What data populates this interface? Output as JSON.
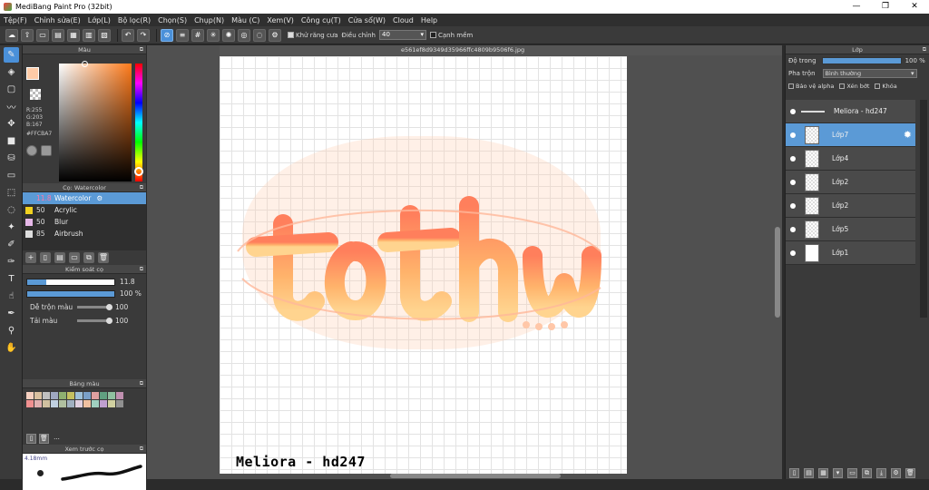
{
  "window": {
    "title": "MediBang Paint Pro (32bit)",
    "minimize": "—",
    "restore": "❐",
    "close": "✕"
  },
  "menu": [
    "Tệp(F)",
    "Chỉnh sửa(E)",
    "Lớp(L)",
    "Bộ lọc(R)",
    "Chọn(S)",
    "Chụp(N)",
    "Màu (C)",
    "Xem(V)",
    "Công cụ(T)",
    "Cửa sổ(W)",
    "Cloud",
    "Help"
  ],
  "toolbar": {
    "antialias_label": "Khử răng cưa",
    "adjust_label": "Điều chỉnh",
    "adjust_value": "40",
    "smooth_label": "Cạnh mềm"
  },
  "color_panel": {
    "title": "Màu",
    "r": "R:255",
    "g": "G:203",
    "b": "B:167",
    "hex": "#FFCBA7",
    "fg_color": "#FFCBA7"
  },
  "brush_panel": {
    "title": "Cọ: Watercolor",
    "brushes": [
      {
        "size": "11.8",
        "name": "Watercolor",
        "color": "#5b9ad6"
      },
      {
        "size": "50",
        "name": "Acrylic",
        "color": "#f0d020"
      },
      {
        "size": "50",
        "name": "Blur",
        "color": "#e6b8e8"
      },
      {
        "size": "85",
        "name": "Airbrush",
        "color": "#dddddd"
      }
    ]
  },
  "brush_control": {
    "title": "Kiểm soát cọ",
    "size_value": "11.8",
    "size_fraction": 0.22,
    "opacity_value": "100 %",
    "blend_label": "Dễ trộn màu",
    "blend_value": "100",
    "amount_label": "Tải màu",
    "amount_value": "100"
  },
  "palette": {
    "title": "Bảng màu",
    "dots": "...",
    "colors": [
      "#f6d0c0",
      "#d9c0a0",
      "#c0c0c0",
      "#9fa8c0",
      "#8fb070",
      "#c4c060",
      "#9ec0d8",
      "#7aa0c8",
      "#e0a0a0",
      "#60a080",
      "#90c0a0",
      "#c090b0",
      "#f09090",
      "#e0b0b0",
      "#d0c0a0",
      "#c0d0e0",
      "#b0c0a0",
      "#a0b0c0",
      "#e0d0e0",
      "#f0c0a0",
      "#a0d0c0",
      "#c0a0d0",
      "#d0d0a0",
      "#909090"
    ]
  },
  "preview": {
    "title": "Xem trước cọ",
    "mm": "4.18mm"
  },
  "document": {
    "filename": "e561ef8d9349d35966ffc4809b9506f6.jpg",
    "signature": "Meliora - hd247"
  },
  "layer_panel": {
    "title": "Lớp",
    "opacity_label": "Độ trong",
    "opacity_value": "100 %",
    "opacity_fraction": 1.0,
    "blend_label": "Pha trộn",
    "blend_value": "Bình thường",
    "protect_alpha": "Bảo vệ alpha",
    "clipping": "Xén bớt",
    "lock": "Khóa",
    "layers": [
      {
        "name": "Meliora - hd247",
        "type": "text"
      },
      {
        "name": "Lớp7",
        "type": "transparent",
        "active": true
      },
      {
        "name": "Lớp4",
        "type": "transparent"
      },
      {
        "name": "Lớp2",
        "type": "transparent"
      },
      {
        "name": "Lớp2",
        "type": "transparent"
      },
      {
        "name": "Lớp5",
        "type": "transparent"
      },
      {
        "name": "Lớp1",
        "type": "plain"
      }
    ]
  }
}
